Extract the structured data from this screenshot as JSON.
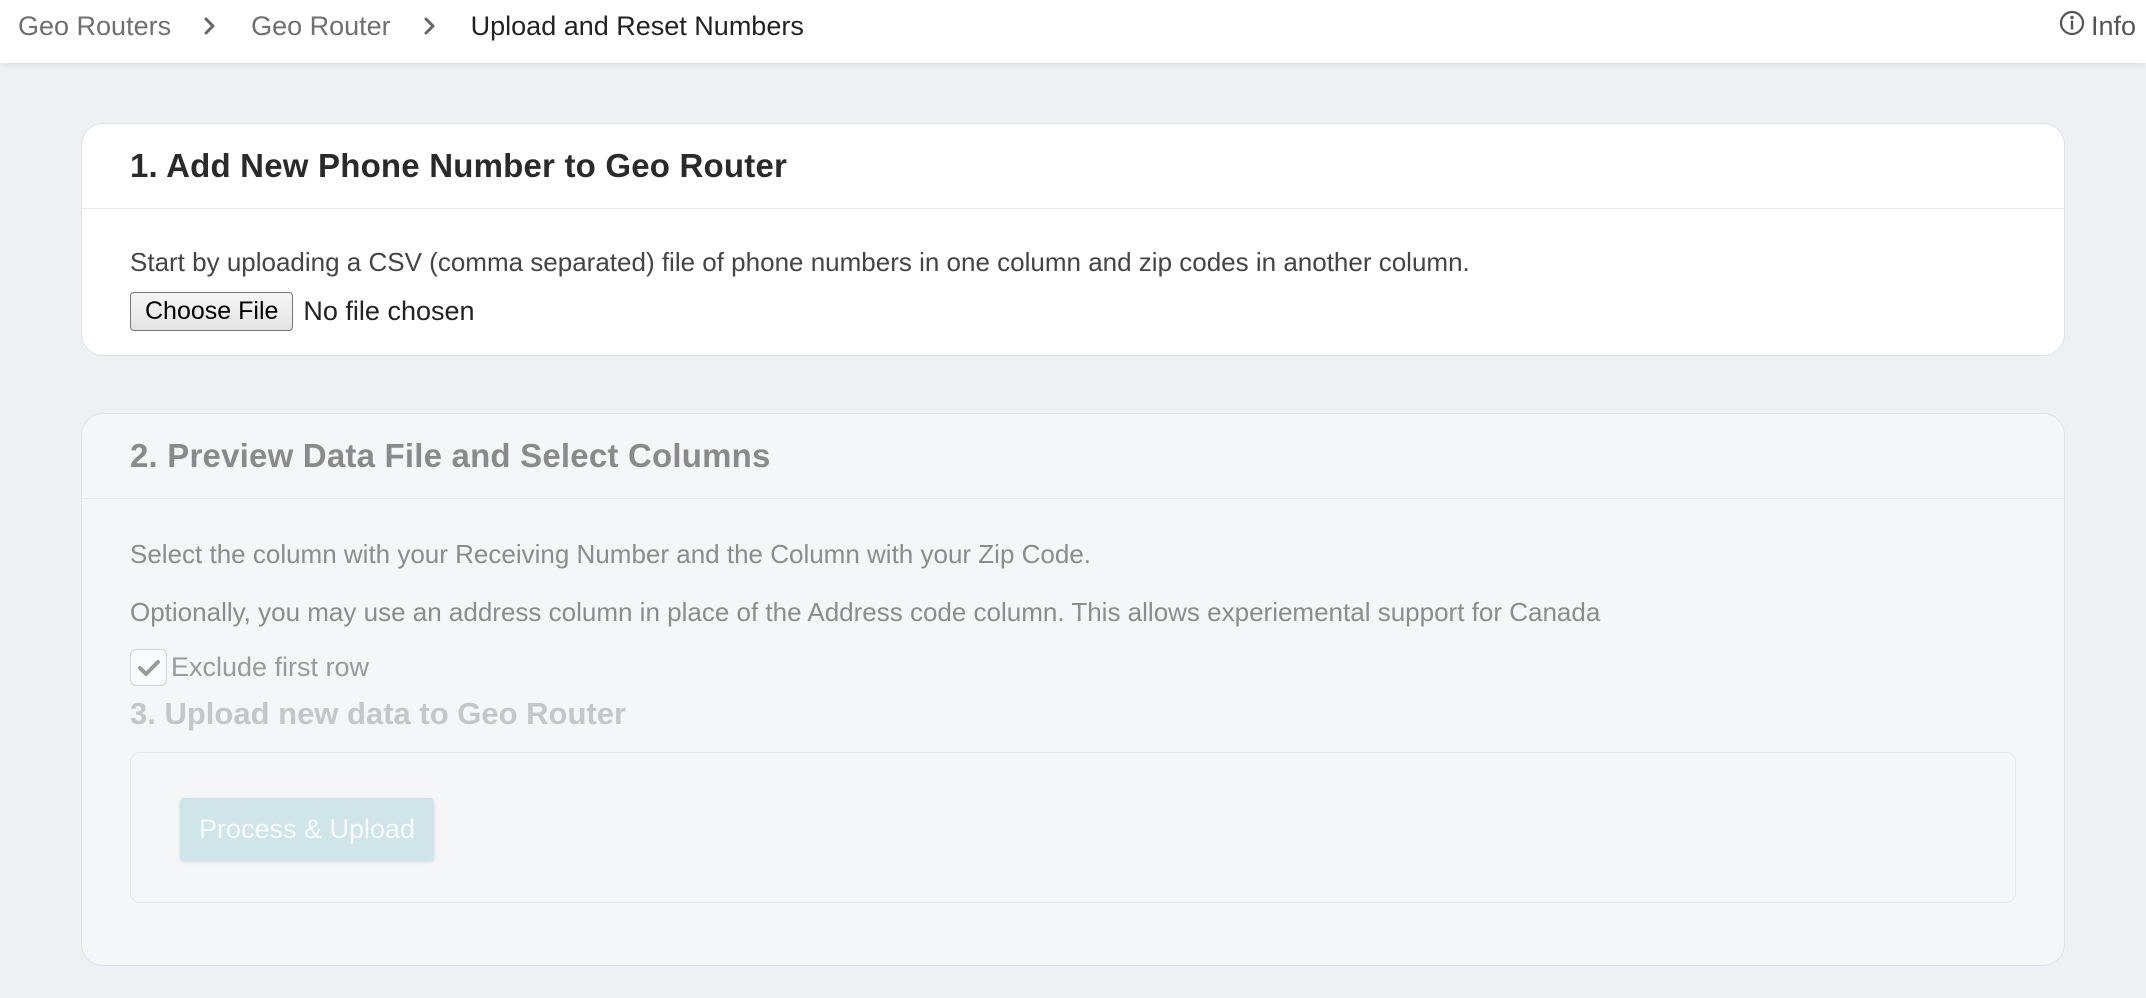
{
  "breadcrumb": {
    "items": [
      "Geo Routers",
      "Geo Router"
    ],
    "current": "Upload and Reset Numbers"
  },
  "header": {
    "info_label": "Info"
  },
  "step1": {
    "title": "1. Add New Phone Number to Geo Router",
    "description": "Start by uploading a CSV (comma separated) file of phone numbers in one column and zip codes in another column.",
    "file_button_label": "Choose File",
    "file_status": "No file chosen"
  },
  "step2": {
    "title": "2. Preview Data File and Select Columns",
    "instruction": "Select the column with your Receiving Number and the Column with your Zip Code.",
    "note": "Optionally, you may use an address column in place of the Address code column. This allows experiemental support for Canada",
    "exclude_label": "Exclude first row",
    "exclude_checked": true
  },
  "step3": {
    "title": "3. Upload new data to Geo Router",
    "button_label": "Process & Upload",
    "button_disabled": true
  },
  "colors": {
    "page_bg": "#eef0f3",
    "card_bg": "#ffffff",
    "disabled_card_bg": "#f5f6f8",
    "disabled_button_bg": "#cfe5ea"
  }
}
